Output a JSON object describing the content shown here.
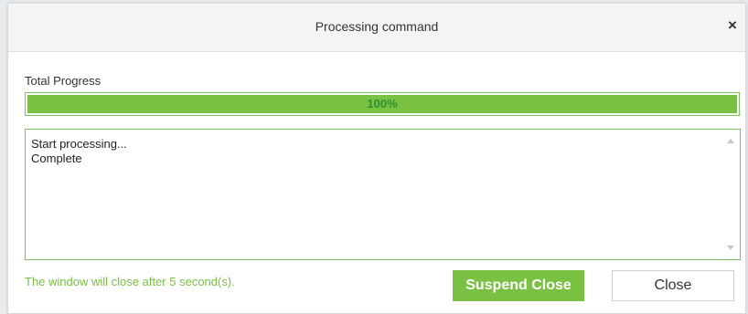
{
  "dialog": {
    "title": "Processing command",
    "close_icon_glyph": "×"
  },
  "progress": {
    "label": "Total Progress",
    "percent": 100,
    "text": "100%",
    "fill_color": "#7ac143"
  },
  "log": {
    "lines": [
      "Start processing...",
      "Complete"
    ]
  },
  "footer": {
    "status_message": "The window will close after 5 second(s).",
    "suspend_label": "Suspend Close",
    "close_label": "Close"
  },
  "colors": {
    "accent": "#7ac143",
    "accent_text": "#2f8f2f"
  }
}
